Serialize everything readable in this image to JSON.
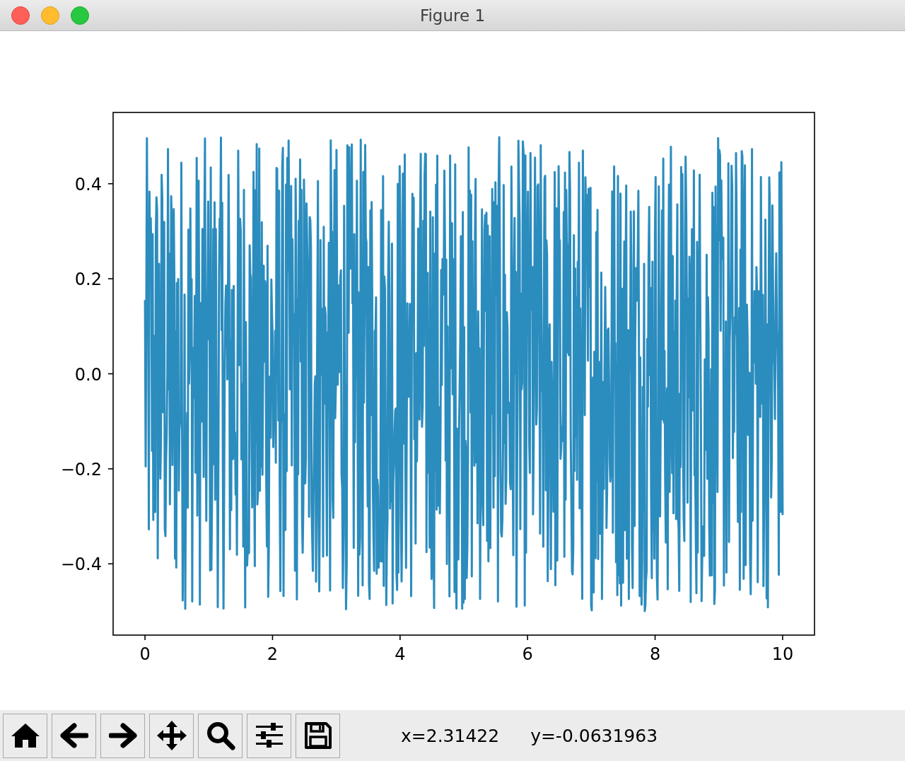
{
  "window": {
    "title": "Figure 1"
  },
  "figure": {
    "chart_data": {
      "type": "line",
      "xlim": [
        -0.5,
        10.5
      ],
      "ylim": [
        -0.55,
        0.55
      ],
      "xticks": [
        {
          "value": 0,
          "label": "0"
        },
        {
          "value": 2,
          "label": "2"
        },
        {
          "value": 4,
          "label": "4"
        },
        {
          "value": 6,
          "label": "6"
        },
        {
          "value": 8,
          "label": "8"
        },
        {
          "value": 10,
          "label": "10"
        }
      ],
      "yticks": [
        {
          "value": -0.4,
          "label": "−0.4"
        },
        {
          "value": -0.2,
          "label": "−0.2"
        },
        {
          "value": 0,
          "label": "0.0"
        },
        {
          "value": 0.2,
          "label": "0.2"
        },
        {
          "value": 0.4,
          "label": "0.4"
        }
      ]
    }
  },
  "toolbar": {
    "buttons": [
      {
        "kind": "home"
      },
      {
        "kind": "back"
      },
      {
        "kind": "forward"
      },
      {
        "kind": "pan"
      },
      {
        "kind": "zoom"
      },
      {
        "kind": "subplots"
      },
      {
        "kind": "save"
      }
    ],
    "x_readout": "x=2.31422",
    "y_readout": "y=-0.0631963"
  }
}
